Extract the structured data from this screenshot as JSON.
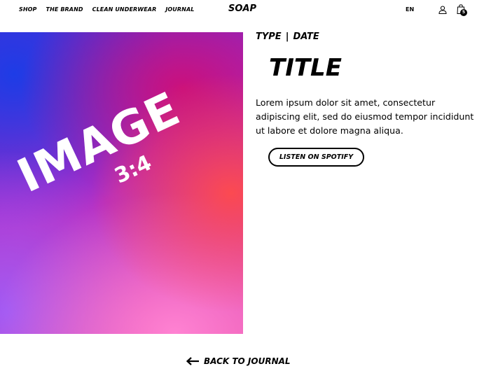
{
  "header": {
    "nav": [
      "SHOP",
      "THE BRAND",
      "CLEAN UNDERWEAR",
      "JOURNAL"
    ],
    "logo": "SOAP",
    "language": "EN",
    "cart_count": "5",
    "icons": {
      "account": "user-icon",
      "cart": "shopping-bag-icon"
    }
  },
  "hero": {
    "placeholder_title": "IMAGE",
    "placeholder_ratio": "3:4"
  },
  "article": {
    "type": "TYPE",
    "separator": "|",
    "date": "DATE",
    "title": "TITLE",
    "body": "Lorem ipsum dolor sit amet, consectetur adipiscing elit, sed do eiusmod tempor incididunt ut labore et dolore magna aliqua.",
    "spotify_label": "LISTEN ON SPOTIFY"
  },
  "footer": {
    "back_label": "BACK TO JOURNAL",
    "back_icon": "arrow-left-icon"
  },
  "colors": {
    "text": "#000000",
    "background": "#ffffff",
    "hero_blue": "#1e3ce6",
    "hero_magenta": "#cd0f78",
    "hero_red": "#ff4b4b",
    "hero_pink": "#ff82d2",
    "hero_violet": "#a05af5"
  }
}
